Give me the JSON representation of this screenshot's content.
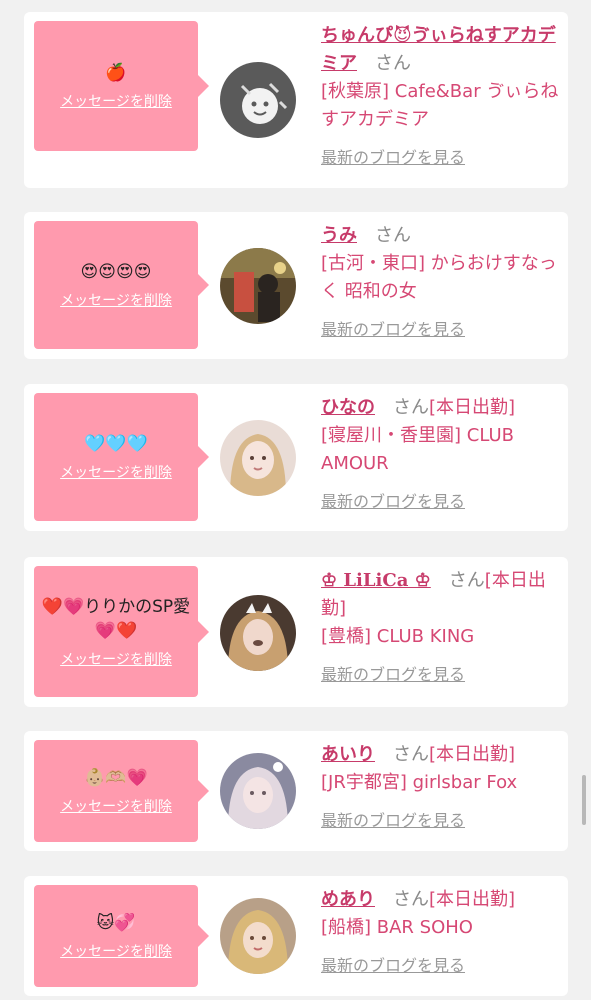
{
  "items": [
    {
      "message": "🍎",
      "delete_label": "メッセージを削除",
      "name_line": "ちゅんぴ😈ゔぃらねすアカデミア",
      "san": "さん",
      "status": "",
      "shop": "[秋葉原] Cafe&Bar ゔぃらねすアカデミア",
      "blog_label": "最新のブログを見る"
    },
    {
      "message": "😍😍😍😍",
      "delete_label": "メッセージを削除",
      "name_line": "うみ",
      "san": "さん",
      "status": "",
      "shop": "[古河・東口] からおけすなっく 昭和の女",
      "blog_label": "最新のブログを見る"
    },
    {
      "message": "🩵🩵🩵",
      "delete_label": "メッセージを削除",
      "name_line": "ひなの",
      "san": "さん",
      "status": "[本日出勤]",
      "shop": "[寝屋川・香里園] CLUB AMOUR",
      "blog_label": "最新のブログを見る"
    },
    {
      "message": "❤️💗りりかのSP愛💗❤️",
      "delete_label": "メッセージを削除",
      "name_line": "♔ LiLiCa ♔",
      "san": "さん",
      "status": "[本日出勤]",
      "shop": "[豊橋] CLUB KING",
      "blog_label": "最新のブログを見る"
    },
    {
      "message": "👶🏼🫶🏼💗",
      "delete_label": "メッセージを削除",
      "name_line": "あいり",
      "san": "さん",
      "status": "[本日出勤]",
      "shop": "[JR宇都宮] girlsbar Fox",
      "blog_label": "最新のブログを見る"
    },
    {
      "message": "🐱💞",
      "delete_label": "メッセージを削除",
      "name_line": "めあり",
      "san": "さん",
      "status": "[本日出勤]",
      "shop": "[船橋] BAR SOHO",
      "blog_label": "最新のブログを見る"
    }
  ],
  "colors": {
    "bubble": "#ff9aae",
    "accent": "#d64874",
    "background": "#f1f1f1"
  }
}
